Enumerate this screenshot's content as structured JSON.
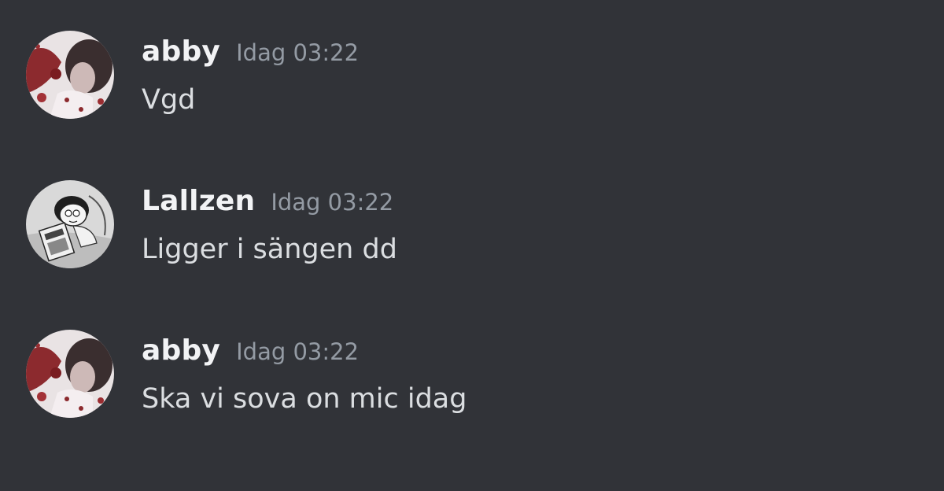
{
  "colors": {
    "background": "#313338",
    "username": "#f2f3f5",
    "timestamp": "#949ba4",
    "message_text": "#dbdee1"
  },
  "messages": [
    {
      "author": "abby",
      "timestamp": "Idag 03:22",
      "content": "Vgd",
      "avatar_icon": "avatar-abby"
    },
    {
      "author": "Lallzen",
      "timestamp": "Idag 03:22",
      "content": "Ligger i sängen dd",
      "avatar_icon": "avatar-lallzen"
    },
    {
      "author": "abby",
      "timestamp": "Idag 03:22",
      "content": "Ska vi sova on mic idag",
      "avatar_icon": "avatar-abby"
    }
  ]
}
